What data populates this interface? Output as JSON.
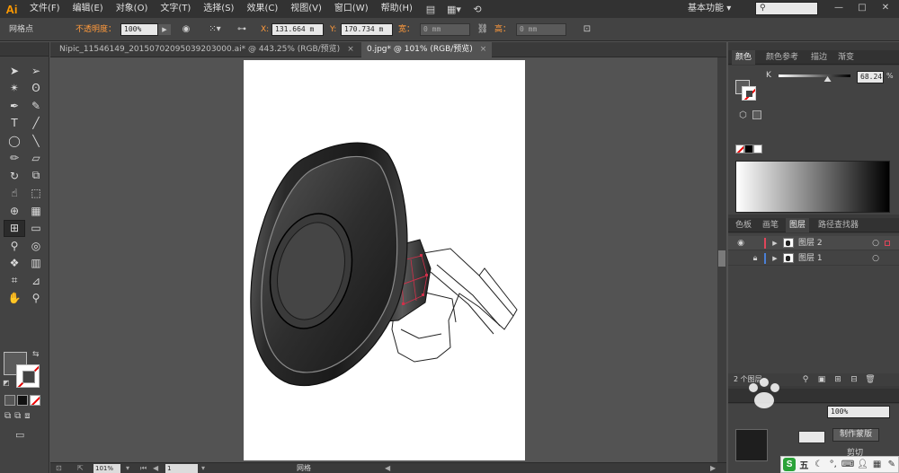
{
  "app": {
    "logo": "Ai",
    "menu": [
      "文件(F)",
      "编辑(E)",
      "对象(O)",
      "文字(T)",
      "选择(S)",
      "效果(C)",
      "视图(V)",
      "窗口(W)",
      "帮助(H)"
    ],
    "workspace": "基本功能",
    "workspace_arrow": "▾",
    "window_controls": [
      "—",
      "□",
      "✕"
    ]
  },
  "control_bar": {
    "selection_label": "网格点",
    "opacity_label": "不透明度：",
    "opacity_value": "100%",
    "x_label": "X:",
    "x_value": "131.664 m",
    "y_label": "Y:",
    "y_value": "170.734 m",
    "width_label": "宽：",
    "width_value": "0 mm",
    "height_label": "高：",
    "height_value": "0 mm"
  },
  "tabs": [
    {
      "label": "Nipic_11546149_20150702095039203000.ai* @ 443.25% (RGB/预览)",
      "close": "×"
    },
    {
      "label": "0.jpg* @ 101% (RGB/预览)",
      "close": "×"
    }
  ],
  "tools": [
    {
      "name": "selection-tool",
      "glyph": "➤"
    },
    {
      "name": "direct-selection-tool",
      "glyph": "➢"
    },
    {
      "name": "magic-wand-tool",
      "glyph": "✴"
    },
    {
      "name": "lasso-tool",
      "glyph": "ʘ"
    },
    {
      "name": "pen-tool",
      "glyph": "✒"
    },
    {
      "name": "curvature-tool",
      "glyph": "✎"
    },
    {
      "name": "type-tool",
      "glyph": "T"
    },
    {
      "name": "line-tool",
      "glyph": "╱"
    },
    {
      "name": "ellipse-tool",
      "glyph": "◯"
    },
    {
      "name": "paintbrush-tool",
      "glyph": "╲"
    },
    {
      "name": "pencil-tool",
      "glyph": "✏"
    },
    {
      "name": "eraser-tool",
      "glyph": "▱"
    },
    {
      "name": "rotate-tool",
      "glyph": "↻"
    },
    {
      "name": "scale-tool",
      "glyph": "⧉"
    },
    {
      "name": "warp-tool",
      "glyph": "☝"
    },
    {
      "name": "free-transform-tool",
      "glyph": "⬚"
    },
    {
      "name": "shape-builder-tool",
      "glyph": "⊕"
    },
    {
      "name": "perspective-grid-tool",
      "glyph": "▦"
    },
    {
      "name": "mesh-tool",
      "glyph": "⊞"
    },
    {
      "name": "gradient-tool",
      "glyph": "▭"
    },
    {
      "name": "eyedropper-tool",
      "glyph": "⚲"
    },
    {
      "name": "blend-tool",
      "glyph": "◎"
    },
    {
      "name": "symbol-sprayer-tool",
      "glyph": "❖"
    },
    {
      "name": "column-graph-tool",
      "glyph": "▥"
    },
    {
      "name": "artboard-tool",
      "glyph": "⌗"
    },
    {
      "name": "slice-tool",
      "glyph": "⊿"
    },
    {
      "name": "hand-tool",
      "glyph": "✋"
    },
    {
      "name": "zoom-tool",
      "glyph": "⚲"
    }
  ],
  "status_bar": {
    "zoom": "101%",
    "page": "1",
    "tool_name": "网格"
  },
  "color_panel": {
    "tabs": [
      "颜色",
      "颜色参考",
      "描边",
      "渐变"
    ],
    "channel_label": "K",
    "k_value": "68.24",
    "k_unit": "%",
    "k_level": 0.6824
  },
  "layers_panel": {
    "tabs": [
      "色板",
      "画笔",
      "图层",
      "路径查找器"
    ],
    "layers": [
      {
        "name": "图层 2"
      },
      {
        "name": "图层 1"
      }
    ],
    "count_label": "2 个图层"
  },
  "transparency_panel": {
    "opacity_value": "100%",
    "make_mask_button": "制作蒙版",
    "clip_label": "剪切"
  },
  "tray": {
    "ime": "S",
    "ime_mode": "五"
  },
  "colors": {
    "accent_orange": "#ff9a00",
    "layer2_color": "#e0455a",
    "layer1_color": "#4a7fd6"
  }
}
